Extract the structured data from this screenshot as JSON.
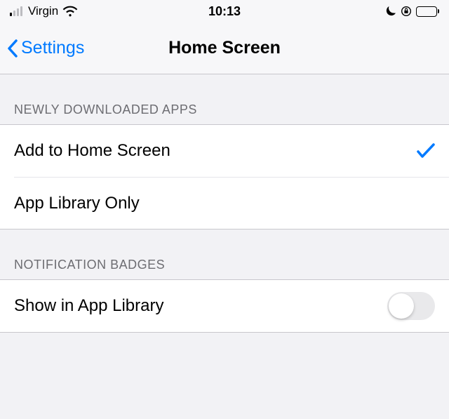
{
  "status_bar": {
    "carrier": "Virgin",
    "time": "10:13"
  },
  "nav": {
    "back_label": "Settings",
    "title": "Home Screen"
  },
  "sections": {
    "newly_downloaded": {
      "header": "NEWLY DOWNLOADED APPS",
      "options": [
        {
          "label": "Add to Home Screen",
          "selected": true
        },
        {
          "label": "App Library Only",
          "selected": false
        }
      ]
    },
    "notification_badges": {
      "header": "NOTIFICATION BADGES",
      "row_label": "Show in App Library",
      "switch_on": false
    }
  }
}
